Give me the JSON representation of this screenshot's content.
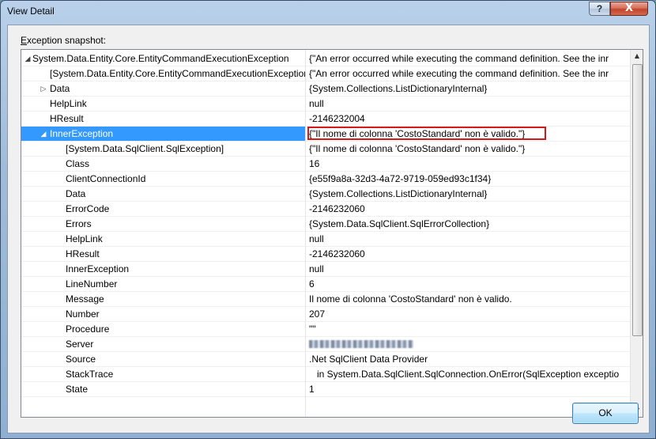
{
  "window": {
    "title": "View Detail",
    "help_glyph": "?",
    "close_glyph": "X"
  },
  "snapshot_label_mnemonic": "E",
  "snapshot_label_rest": "xception snapshot:",
  "ok_label": "OK",
  "rows": [
    {
      "name": "System.Data.Entity.Core.EntityCommandExecutionException",
      "value": "{\"An error occurred while executing the command definition. See the inr",
      "indent": 0,
      "expander": "expanded"
    },
    {
      "name": "[System.Data.Entity.Core.EntityCommandExecutionException]",
      "value": "{\"An error occurred while executing the command definition. See the inr",
      "indent": 1,
      "expander": "none"
    },
    {
      "name": "Data",
      "value": "{System.Collections.ListDictionaryInternal}",
      "indent": 1,
      "expander": "collapsed"
    },
    {
      "name": "HelpLink",
      "value": "null",
      "indent": 1,
      "expander": "none"
    },
    {
      "name": "HResult",
      "value": "-2146232004",
      "indent": 1,
      "expander": "none"
    },
    {
      "name": "InnerException",
      "value": "{\"Il nome di colonna 'CostoStandard' non è valido.\"}",
      "indent": 1,
      "expander": "expanded",
      "selected": true,
      "highlighted": true
    },
    {
      "name": "[System.Data.SqlClient.SqlException]",
      "value": "{\"Il nome di colonna 'CostoStandard' non è valido.\"}",
      "indent": 2,
      "expander": "none"
    },
    {
      "name": "Class",
      "value": "16",
      "indent": 2,
      "expander": "none"
    },
    {
      "name": "ClientConnectionId",
      "value": "{e55f9a8a-32d3-4a72-9719-059ed93c1f34}",
      "indent": 2,
      "expander": "none"
    },
    {
      "name": "Data",
      "value": "{System.Collections.ListDictionaryInternal}",
      "indent": 2,
      "expander": "none"
    },
    {
      "name": "ErrorCode",
      "value": "-2146232060",
      "indent": 2,
      "expander": "none"
    },
    {
      "name": "Errors",
      "value": "{System.Data.SqlClient.SqlErrorCollection}",
      "indent": 2,
      "expander": "none"
    },
    {
      "name": "HelpLink",
      "value": "null",
      "indent": 2,
      "expander": "none"
    },
    {
      "name": "HResult",
      "value": "-2146232060",
      "indent": 2,
      "expander": "none"
    },
    {
      "name": "InnerException",
      "value": "null",
      "indent": 2,
      "expander": "none"
    },
    {
      "name": "LineNumber",
      "value": "6",
      "indent": 2,
      "expander": "none"
    },
    {
      "name": "Message",
      "value": "Il nome di colonna 'CostoStandard' non è valido.",
      "indent": 2,
      "expander": "none"
    },
    {
      "name": "Number",
      "value": "207",
      "indent": 2,
      "expander": "none"
    },
    {
      "name": "Procedure",
      "value": "\"\"",
      "indent": 2,
      "expander": "none"
    },
    {
      "name": "Server",
      "value": "",
      "indent": 2,
      "expander": "none",
      "redacted": true
    },
    {
      "name": "Source",
      "value": ".Net SqlClient Data Provider",
      "indent": 2,
      "expander": "none"
    },
    {
      "name": "StackTrace",
      "value": "in System.Data.SqlClient.SqlConnection.OnError(SqlException exceptio",
      "indent": 2,
      "expander": "none",
      "stack": true
    },
    {
      "name": "State",
      "value": "1",
      "indent": 2,
      "expander": "none"
    }
  ]
}
